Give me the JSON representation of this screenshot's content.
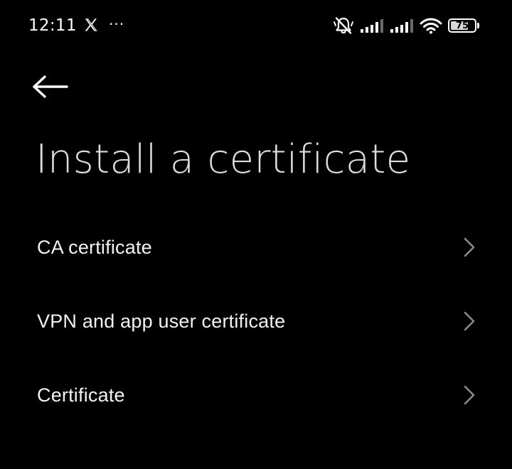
{
  "status_bar": {
    "time": "12:11",
    "more_indicator": "···",
    "battery_level": "75",
    "battery_fraction": 0.75,
    "icons": [
      "x-logo-icon",
      "mute-icon",
      "signal-icon",
      "signal-icon",
      "wifi-icon",
      "battery-icon"
    ]
  },
  "header": {
    "back_icon": "arrow-left-icon",
    "title": "Install a certificate"
  },
  "list": {
    "items": [
      {
        "label": "CA certificate",
        "icon": "chevron-right-icon"
      },
      {
        "label": "VPN and app user certificate",
        "icon": "chevron-right-icon"
      },
      {
        "label": "Certificate",
        "icon": "chevron-right-icon"
      }
    ]
  },
  "colors": {
    "background": "#000000",
    "title": "#dcdcdc",
    "item_text": "#f2f2f2",
    "chevron": "#8a8a8a"
  }
}
